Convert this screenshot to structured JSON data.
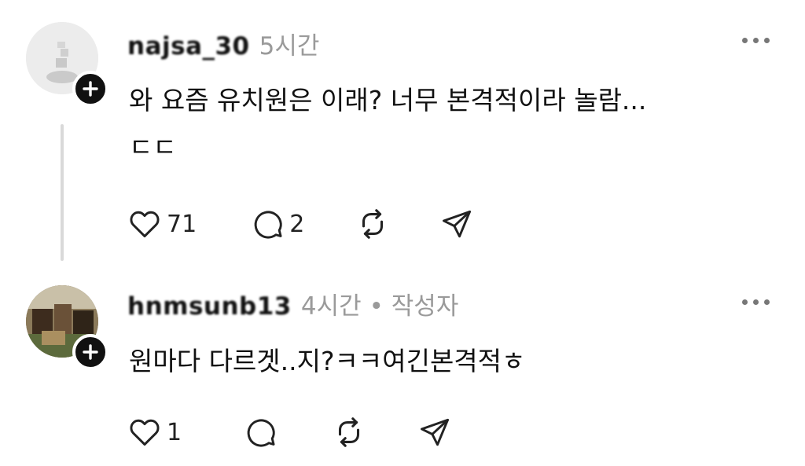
{
  "comments": [
    {
      "username": "najsa_30",
      "time": "5시간",
      "text_line1": "와 요즘 유치원은 이래? 너무 본격적이라 놀람...",
      "text_line2": "ㄷㄷ",
      "likes": "71",
      "replies": "2"
    },
    {
      "username": "hnmsunb13",
      "time": "4시간",
      "author_badge": "• 작성자",
      "text": "원마다 다르겟..지?ㅋㅋ여긴본격적ㅎ",
      "likes": "1"
    }
  ],
  "icons": [
    "heart-icon",
    "comment-icon",
    "repost-icon",
    "share-icon",
    "more-icon",
    "follow-plus-icon"
  ]
}
